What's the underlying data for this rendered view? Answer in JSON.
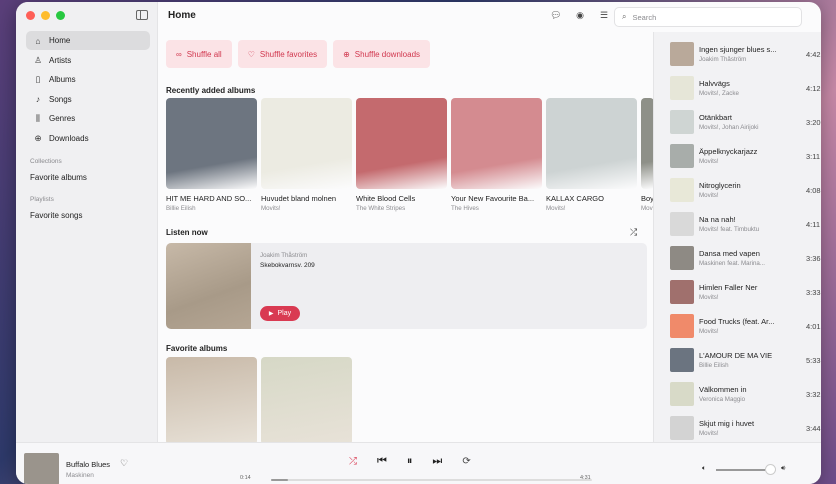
{
  "sidebar": {
    "nav": [
      {
        "label": "Home",
        "icon": "home-icon",
        "glyph": "⌂",
        "active": true
      },
      {
        "label": "Artists",
        "icon": "artists-icon",
        "glyph": "♙",
        "active": false
      },
      {
        "label": "Albums",
        "icon": "albums-icon",
        "glyph": "▯",
        "active": false
      },
      {
        "label": "Songs",
        "icon": "songs-icon",
        "glyph": "♪",
        "active": false
      },
      {
        "label": "Genres",
        "icon": "genres-icon",
        "glyph": "⫼",
        "active": false
      },
      {
        "label": "Downloads",
        "icon": "downloads-icon",
        "glyph": "⊕",
        "active": false
      }
    ],
    "collections_label": "Collections",
    "collections": [
      "Favorite albums"
    ],
    "playlists_label": "Playlists",
    "playlists": [
      "Favorite songs"
    ]
  },
  "header": {
    "title": "Home"
  },
  "search": {
    "placeholder": "Search"
  },
  "shuffle": [
    {
      "label": "Shuffle all",
      "glyph": "∞"
    },
    {
      "label": "Shuffle favorites",
      "glyph": "♡"
    },
    {
      "label": "Shuffle downloads",
      "glyph": "⊕"
    }
  ],
  "recent": {
    "title": "Recently added albums",
    "albums": [
      {
        "name": "HIT ME HARD AND SO...",
        "artist": "Billie Eilish",
        "color": "#6d7580"
      },
      {
        "name": "Huvudet bland molnen",
        "artist": "Movits!",
        "color": "#ecebe2"
      },
      {
        "name": "White Blood Cells",
        "artist": "The White Stripes",
        "color": "#c46a6e"
      },
      {
        "name": "Your New Favourite Ba...",
        "artist": "The Hives",
        "color": "#d48b90"
      },
      {
        "name": "KALLAX CARGO",
        "artist": "Movits!",
        "color": "#cdd3d3"
      },
      {
        "name": "Boy",
        "artist": "Movits!",
        "color": "#8e9088"
      }
    ]
  },
  "listen_now": {
    "title": "Listen now",
    "artist": "Joakim Thåström",
    "song": "Skebokvarnsv. 209",
    "play_label": "Play"
  },
  "favorites": {
    "title": "Favorite albums",
    "colors": [
      "#c8b9a8",
      "#d6d8c6"
    ]
  },
  "queue": [
    {
      "title": "Ingen sjunger blues s...",
      "artist": "Joakim Thåström",
      "duration": "4:42",
      "color": "#b9a99a"
    },
    {
      "title": "Halvvägs",
      "artist": "Movits!, Zacke",
      "duration": "4:12",
      "color": "#e6e6d8"
    },
    {
      "title": "Otänkbart",
      "artist": "Movits!, Johan Airijoki",
      "duration": "3:20",
      "color": "#cfd5d3"
    },
    {
      "title": "Äppelknyckarjazz",
      "artist": "Movits!",
      "duration": "3:11",
      "color": "#a8adaa"
    },
    {
      "title": "Nitroglycerin",
      "artist": "Movits!",
      "duration": "4:08",
      "color": "#e8e8d8"
    },
    {
      "title": "Na na nah!",
      "artist": "Movits! feat. Timbuktu",
      "duration": "4:11",
      "color": "#d9d9d9"
    },
    {
      "title": "Dansa med vapen",
      "artist": "Maskinen feat. Marina...",
      "duration": "3:36",
      "color": "#8e8a84"
    },
    {
      "title": "Himlen Faller Ner",
      "artist": "Movits!",
      "duration": "3:33",
      "color": "#a0706d"
    },
    {
      "title": "Food Trucks (feat. Ar...",
      "artist": "Movits!",
      "duration": "4:01",
      "color": "#f08a6a"
    },
    {
      "title": "L'AMOUR DE MA VIE",
      "artist": "Billie Eilish",
      "duration": "5:33",
      "color": "#6b7480"
    },
    {
      "title": "Välkommen in",
      "artist": "Veronica Maggio",
      "duration": "3:32",
      "color": "#d8dac8"
    },
    {
      "title": "Skjut mig i huvet",
      "artist": "Movits!",
      "duration": "3:44",
      "color": "#d3d3d3"
    }
  ],
  "player": {
    "title": "Buffalo Blues",
    "artist": "Maskinen",
    "elapsed": "0:14",
    "total": "4:31",
    "progress": 0.052,
    "volume": 0.82
  }
}
